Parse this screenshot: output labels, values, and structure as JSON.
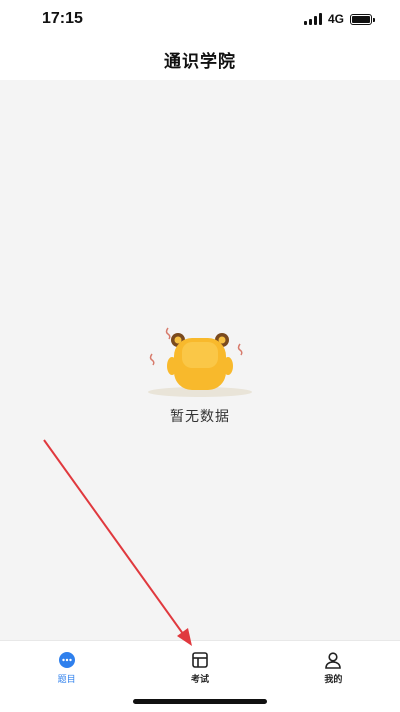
{
  "status_bar": {
    "time": "17:15",
    "network": "4G",
    "icons": [
      "signal-icon",
      "battery-icon"
    ]
  },
  "header": {
    "title": "通识学院"
  },
  "main": {
    "empty_state": {
      "illustration": "empty-mascot-illustration",
      "text": "暂无数据"
    }
  },
  "tab_bar": {
    "tabs": [
      {
        "label": "题目",
        "icon": "chat-bubble-icon",
        "active": true
      },
      {
        "label": "考试",
        "icon": "exam-card-icon",
        "active": false
      },
      {
        "label": "我的",
        "icon": "person-icon",
        "active": false
      }
    ],
    "active_color": "#2f80ed"
  },
  "annotation": {
    "type": "red-arrow",
    "color": "#e0393e",
    "points_to": "tab-exam"
  }
}
